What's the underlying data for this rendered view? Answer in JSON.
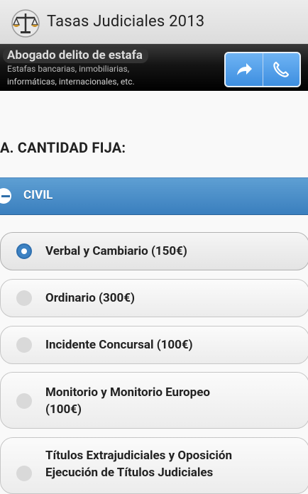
{
  "actionbar": {
    "title": "Tasas Judiciales 2013",
    "app_icon": "scales-of-justice-icon"
  },
  "ad": {
    "headline": "Abogado delito de estafa",
    "line1": "Estafas bancarias, inmobiliarias,",
    "line2": "informáticas, internacionales, etc.",
    "buttons": [
      "share-arrow-icon",
      "phone-icon"
    ]
  },
  "main": {
    "section_title": "A. CANTIDAD FIJA:",
    "collapsible": {
      "label": "CIVIL",
      "expanded": true
    },
    "options": [
      {
        "label": "Verbal y Cambiario (150€)",
        "selected": true
      },
      {
        "label": "Ordinario (300€)",
        "selected": false
      },
      {
        "label": "Incidente Concursal (100€)",
        "selected": false
      },
      {
        "label_line1": "Monitorio y Monitorio Europeo",
        "label_line2": "(100€)",
        "selected": false
      },
      {
        "label_line1": "Títulos Extrajudiciales y Oposición",
        "label_line2": "Ejecución de Títulos Judiciales",
        "selected": false
      }
    ]
  },
  "colors": {
    "accent_blue": "#3a7fbe",
    "ad_button_blue": "#4d9ae8",
    "actionbar_bg": "#e4e4e4"
  }
}
